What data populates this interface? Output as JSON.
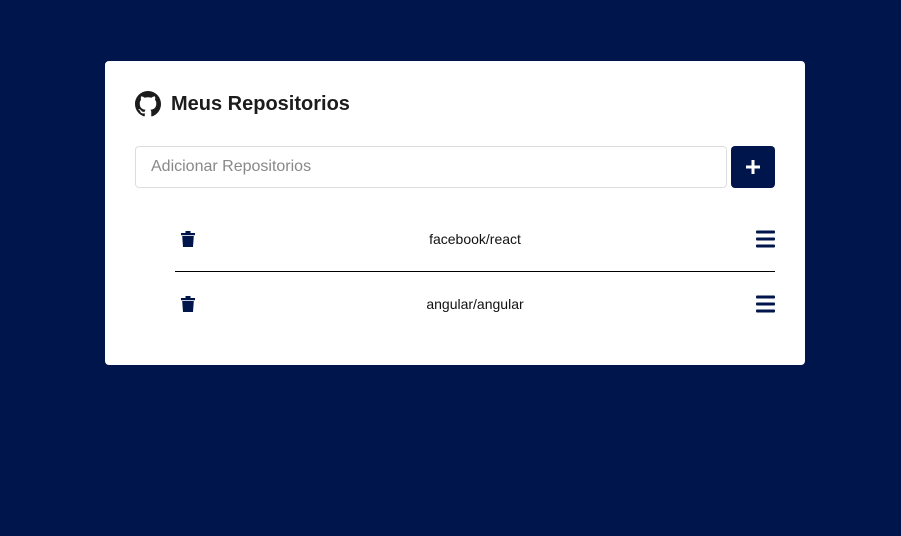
{
  "header": {
    "title": "Meus Repositorios",
    "icon": "github-icon"
  },
  "form": {
    "placeholder": "Adicionar Repositorios",
    "value": "",
    "add_icon": "plus-icon"
  },
  "repositories": [
    {
      "name": "facebook/react",
      "delete_icon": "trash-icon",
      "menu_icon": "bars-icon"
    },
    {
      "name": "angular/angular",
      "delete_icon": "trash-icon",
      "menu_icon": "bars-icon"
    }
  ],
  "colors": {
    "background": "#00154b",
    "card": "#ffffff",
    "accent": "#00154b"
  }
}
